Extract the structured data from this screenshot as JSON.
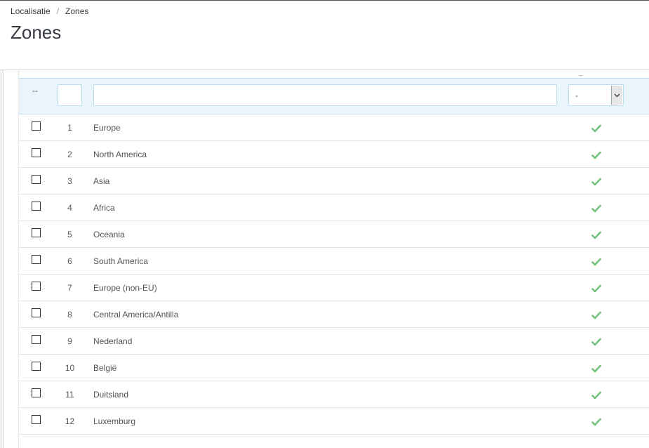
{
  "breadcrumb": {
    "parent": "Localisatie",
    "separator": "/",
    "current": "Zones"
  },
  "page": {
    "title": "Zones"
  },
  "filters": {
    "bulk_placeholder": "--",
    "id_value": "",
    "name_value": "",
    "active_select_value": "-"
  },
  "colors": {
    "check": "#72c279",
    "filter_bg": "#eaf4fb"
  },
  "zones": [
    {
      "id": "1",
      "name": "Europe",
      "active": true
    },
    {
      "id": "2",
      "name": "North America",
      "active": true
    },
    {
      "id": "3",
      "name": "Asia",
      "active": true
    },
    {
      "id": "4",
      "name": "Africa",
      "active": true
    },
    {
      "id": "5",
      "name": "Oceania",
      "active": true
    },
    {
      "id": "6",
      "name": "South America",
      "active": true
    },
    {
      "id": "7",
      "name": "Europe (non-EU)",
      "active": true
    },
    {
      "id": "8",
      "name": "Central America/Antilla",
      "active": true
    },
    {
      "id": "9",
      "name": "Nederland",
      "active": true
    },
    {
      "id": "10",
      "name": "België",
      "active": true
    },
    {
      "id": "11",
      "name": "Duitsland",
      "active": true
    },
    {
      "id": "12",
      "name": "Luxemburg",
      "active": true
    }
  ]
}
